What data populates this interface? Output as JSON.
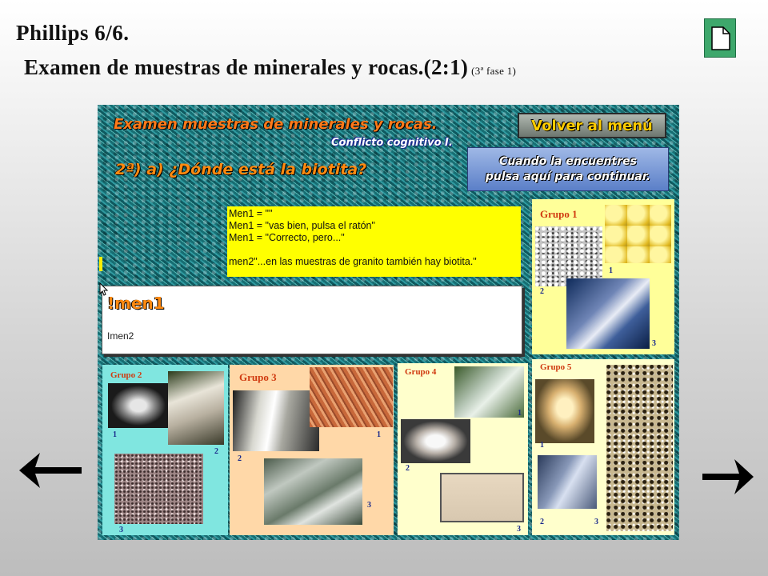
{
  "header": {
    "title_line1": "Phillips 6/6.",
    "title_line2": "Examen de muestras de minerales y rocas.(2:1)",
    "phase": "(3ª fase 1)"
  },
  "slide": {
    "title": "Examen muestras de minerales y rocas.",
    "subtitle": "Conflicto cognitivo I.",
    "question": "2ª)   a) ¿Dónde está la biotita?",
    "menu_button": "Volver al menú",
    "continue_line1": "Cuando la encuentres",
    "continue_line2": "pulsa aquí para continuar.",
    "yellow_lines": [
      "Men1 = \"\"",
      "Men1 = \"vas bien, pulsa el ratón\"",
      "Men1 = \"Correcto, pero...\"",
      "men2\"...en las muestras de granito también hay biotita.\""
    ],
    "men1_label": "!men1",
    "men2_label": "Imen2"
  },
  "groups": [
    {
      "name": "Grupo 1",
      "numbers": [
        "1",
        "2",
        "3"
      ]
    },
    {
      "name": "Grupo 2",
      "numbers": [
        "1",
        "2",
        "3"
      ]
    },
    {
      "name": "Grupo 3",
      "numbers": [
        "1",
        "2",
        "3"
      ]
    },
    {
      "name": "Grupo 4",
      "numbers": [
        "1",
        "2",
        "3"
      ]
    },
    {
      "name": "Grupo 5",
      "numbers": [
        "1",
        "2",
        "3"
      ]
    }
  ],
  "icons": {
    "doc_button": "document-icon",
    "prev": "arrow-left-icon",
    "next": "arrow-right-icon"
  },
  "colors": {
    "accent_orange": "#ff7a1a",
    "yellow_box": "#ffff00",
    "group_bg": "#ffff99",
    "doc_button_green": "#3ea86c"
  }
}
